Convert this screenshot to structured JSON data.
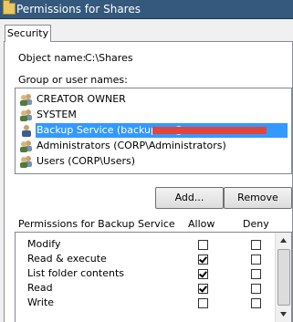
{
  "window": {
    "title": "Permissions for Shares",
    "icon": "folder-icon"
  },
  "tabs": [
    {
      "label": "Security",
      "selected": true
    }
  ],
  "object": {
    "label": "Object name:",
    "value": "C:\\Shares"
  },
  "group_list": {
    "label": "Group or user names:",
    "items": [
      {
        "label": "CREATOR OWNER",
        "icon": "group-icon",
        "selected": false
      },
      {
        "label": "SYSTEM",
        "icon": "group-icon",
        "selected": false
      },
      {
        "label": "Backup Service (backupsvc@",
        "icon": "user-icon",
        "selected": true,
        "redacted": true
      },
      {
        "label": "Administrators (CORP\\Administrators)",
        "icon": "group-icon",
        "selected": false
      },
      {
        "label": "Users (CORP\\Users)",
        "icon": "group-icon",
        "selected": false
      }
    ]
  },
  "buttons": {
    "add": "Add...",
    "remove": "Remove"
  },
  "permissions": {
    "title": "Permissions for Backup Service",
    "allow_header": "Allow",
    "deny_header": "Deny",
    "rows": [
      {
        "name": "Modify",
        "allow": false,
        "deny": false
      },
      {
        "name": "Read & execute",
        "allow": true,
        "deny": false
      },
      {
        "name": "List folder contents",
        "allow": true,
        "deny": false
      },
      {
        "name": "Read",
        "allow": true,
        "deny": false
      },
      {
        "name": "Write",
        "allow": false,
        "deny": false
      }
    ]
  },
  "colors": {
    "titlebar": "#35587d",
    "selection": "#3399ff",
    "redaction": "#e0463e"
  }
}
